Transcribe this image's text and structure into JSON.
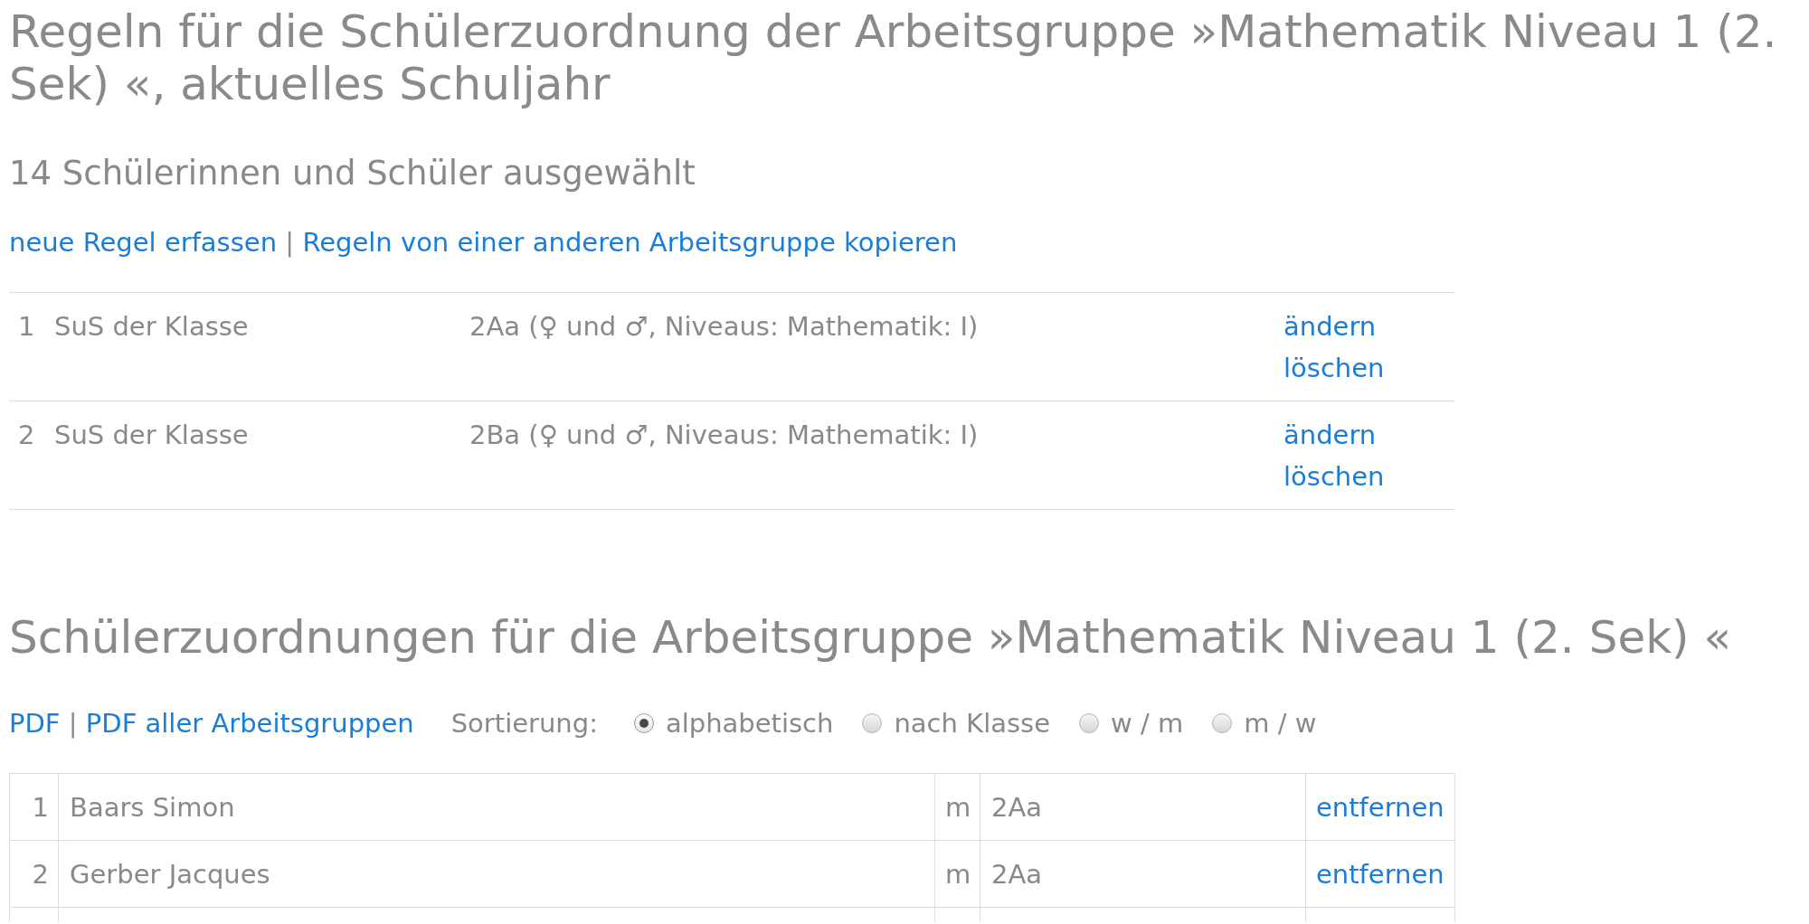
{
  "rules_section": {
    "title": "Regeln für die Schülerzuordnung der Arbeitsgruppe »Mathematik Niveau 1 (2. Sek) «, aktuelles Schuljahr",
    "selection_count": "14 Schülerinnen und Schüler ausgewählt",
    "links": [
      "neue Regel erfassen",
      "Regeln von einer anderen Arbeitsgruppe kopieren"
    ],
    "link_separator": "|",
    "rules": [
      {
        "number": "1",
        "subject": "SuS der Klasse",
        "criteria": "2Aa (♀ und ♂, Niveaus: Mathematik: I)",
        "actions": [
          "ändern",
          "löschen"
        ]
      },
      {
        "number": "2",
        "subject": "SuS der Klasse",
        "criteria": "2Ba (♀ und ♂, Niveaus: Mathematik: I)",
        "actions": [
          "ändern",
          "löschen"
        ]
      }
    ]
  },
  "assignments_section": {
    "title": "Schülerzuordnungen für die Arbeitsgruppe »Mathematik Niveau 1 (2. Sek) «",
    "links": [
      "PDF",
      "PDF aller Arbeitsgruppen"
    ],
    "link_separator": "|",
    "sort": {
      "label": "Sortierung:",
      "options": [
        {
          "label": "alphabetisch",
          "selected": true
        },
        {
          "label": "nach Klasse",
          "selected": false
        },
        {
          "label": "w / m",
          "selected": false
        },
        {
          "label": "m / w",
          "selected": false
        }
      ]
    },
    "students": [
      {
        "number": "1",
        "name": "Baars Simon",
        "gender": "m",
        "class": "2Aa",
        "action": "entfernen"
      },
      {
        "number": "2",
        "name": "Gerber Jacques",
        "gender": "m",
        "class": "2Aa",
        "action": "entfernen"
      }
    ]
  }
}
